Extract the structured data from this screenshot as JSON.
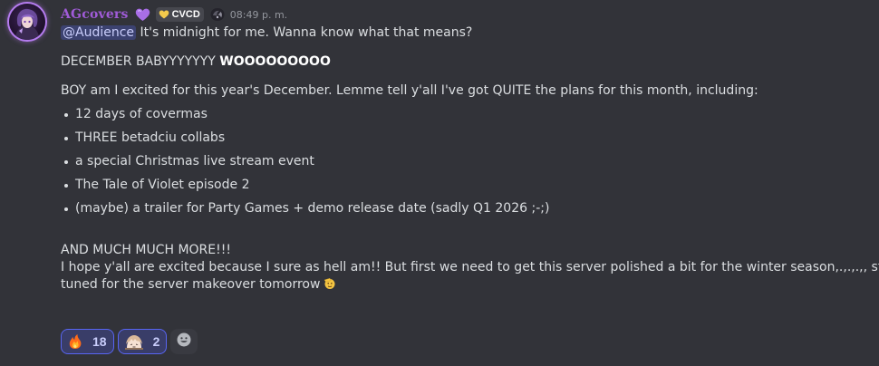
{
  "message": {
    "author": "AGcovers",
    "author_color": "#a05bd8",
    "author_emoji": "purple-heart-icon",
    "server_tag": {
      "icon": "gold-heart-icon",
      "label": "CVCD"
    },
    "role_icon": "dark-emblem-icon",
    "timestamp": "08:49 p. m.",
    "mention": "@Audience",
    "intro": "It's midnight for me. Wanna know what that means?",
    "hype_plain": "DECEMBER BABYYYYYYY ",
    "hype_bold": "WOOOOOOOOO",
    "plans_intro": "BOY am I excited for this year's December. Lemme tell y'all I've got QUITE the plans for this month, including:",
    "plans": [
      "12 days of covermas",
      "THREE betadciu collabs",
      "a special Christmas live stream event",
      "The Tale of Violet episode 2",
      "(maybe) a trailer for Party Games + demo release date (sadly Q1 2026 ;-;)"
    ],
    "more": "AND MUCH MUCH MORE!!!",
    "closing_line1": "I hope y'all are excited because I sure as hell am!! But first we need to get this server polished a bit for the winter season,.,.,.,, stay",
    "closing_line2": "tuned for the server makeover tomorrow",
    "closing_emoji": "saluting-face-icon"
  },
  "reactions": [
    {
      "emoji": "fire-icon",
      "count": "18"
    },
    {
      "emoji": "custom-character-emoji-icon",
      "count": "2"
    }
  ],
  "add_reaction_icon": "add-reaction-smile-icon",
  "accent_color": "#5865f2"
}
